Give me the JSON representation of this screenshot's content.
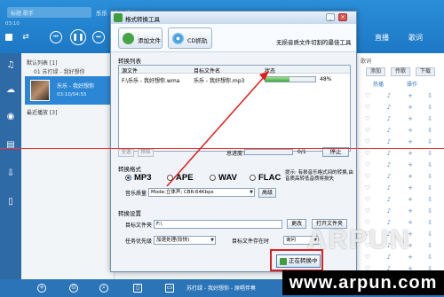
{
  "player": {
    "search_placeholder": "标题 歌手",
    "now_playing": "乐乐 - 我好想你",
    "time": "03:10",
    "top_song_right": "我好想你",
    "tabs": [
      "直播",
      "歌词"
    ],
    "playlist_header": "默认列表 [1]",
    "playlist_item": "01 苏打绿 - 我好想你",
    "selected_artist": "乐乐 - 我好想你",
    "selected_time": "03:10/04:55",
    "recent_header": "最近播放 [3]",
    "right_header": "歌词",
    "right_buttons": [
      "添加",
      "传歌",
      "下载"
    ],
    "right_cols": [
      "热播",
      "操作"
    ],
    "bottom_song": "苏打绿 - 我好想你 - 原唱伴奏"
  },
  "dialog": {
    "title": "格式转换工具",
    "add_file": "添加文件",
    "cd_rip": "CD抓轨",
    "slogan": "无损音质文件切割的最佳工具",
    "list_label": "转换列表",
    "columns": [
      "源文件",
      "目标文件名",
      "状态"
    ],
    "row": {
      "source": "F:\\乐乐 - 我好想你.wma",
      "target": "乐乐 - 我好想你.mp3",
      "progress_text": "48%",
      "progress": 0.48
    },
    "clear_btn": "全选",
    "remove_btn": "移除",
    "total_label": "总进度:",
    "total_count": "0/1",
    "stop_btn": "停止",
    "format_label": "转换格式",
    "formats": [
      "MP3",
      "APE",
      "WAV",
      "FLAC"
    ],
    "selected_format": "MP3",
    "tip": "提示: 有损音乐格式间的转换,由音质高转低音质将损失",
    "quality_label": "音乐质量",
    "quality_value": "Mode:立体声; CBR:64Kbps",
    "advanced_btn": "高级",
    "settings_label": "转换设置",
    "target_folder_label": "目标文件夹",
    "target_folder_value": "F:\\",
    "change_btn": "更改",
    "open_folder_btn": "打开文件夹",
    "priority_label": "任务优先级",
    "priority_value": "加速处理(较快)",
    "exists_label": "目标文件存在时",
    "exists_value": "询问",
    "converting_btn": "正在转换中"
  },
  "watermark": {
    "brand": "ARPUN",
    "url": "www.arpun.com"
  },
  "colors": {
    "accent_blue": "#2b8ed9",
    "annotation_red": "#e11d1d",
    "progress_green": "#3aa934"
  }
}
